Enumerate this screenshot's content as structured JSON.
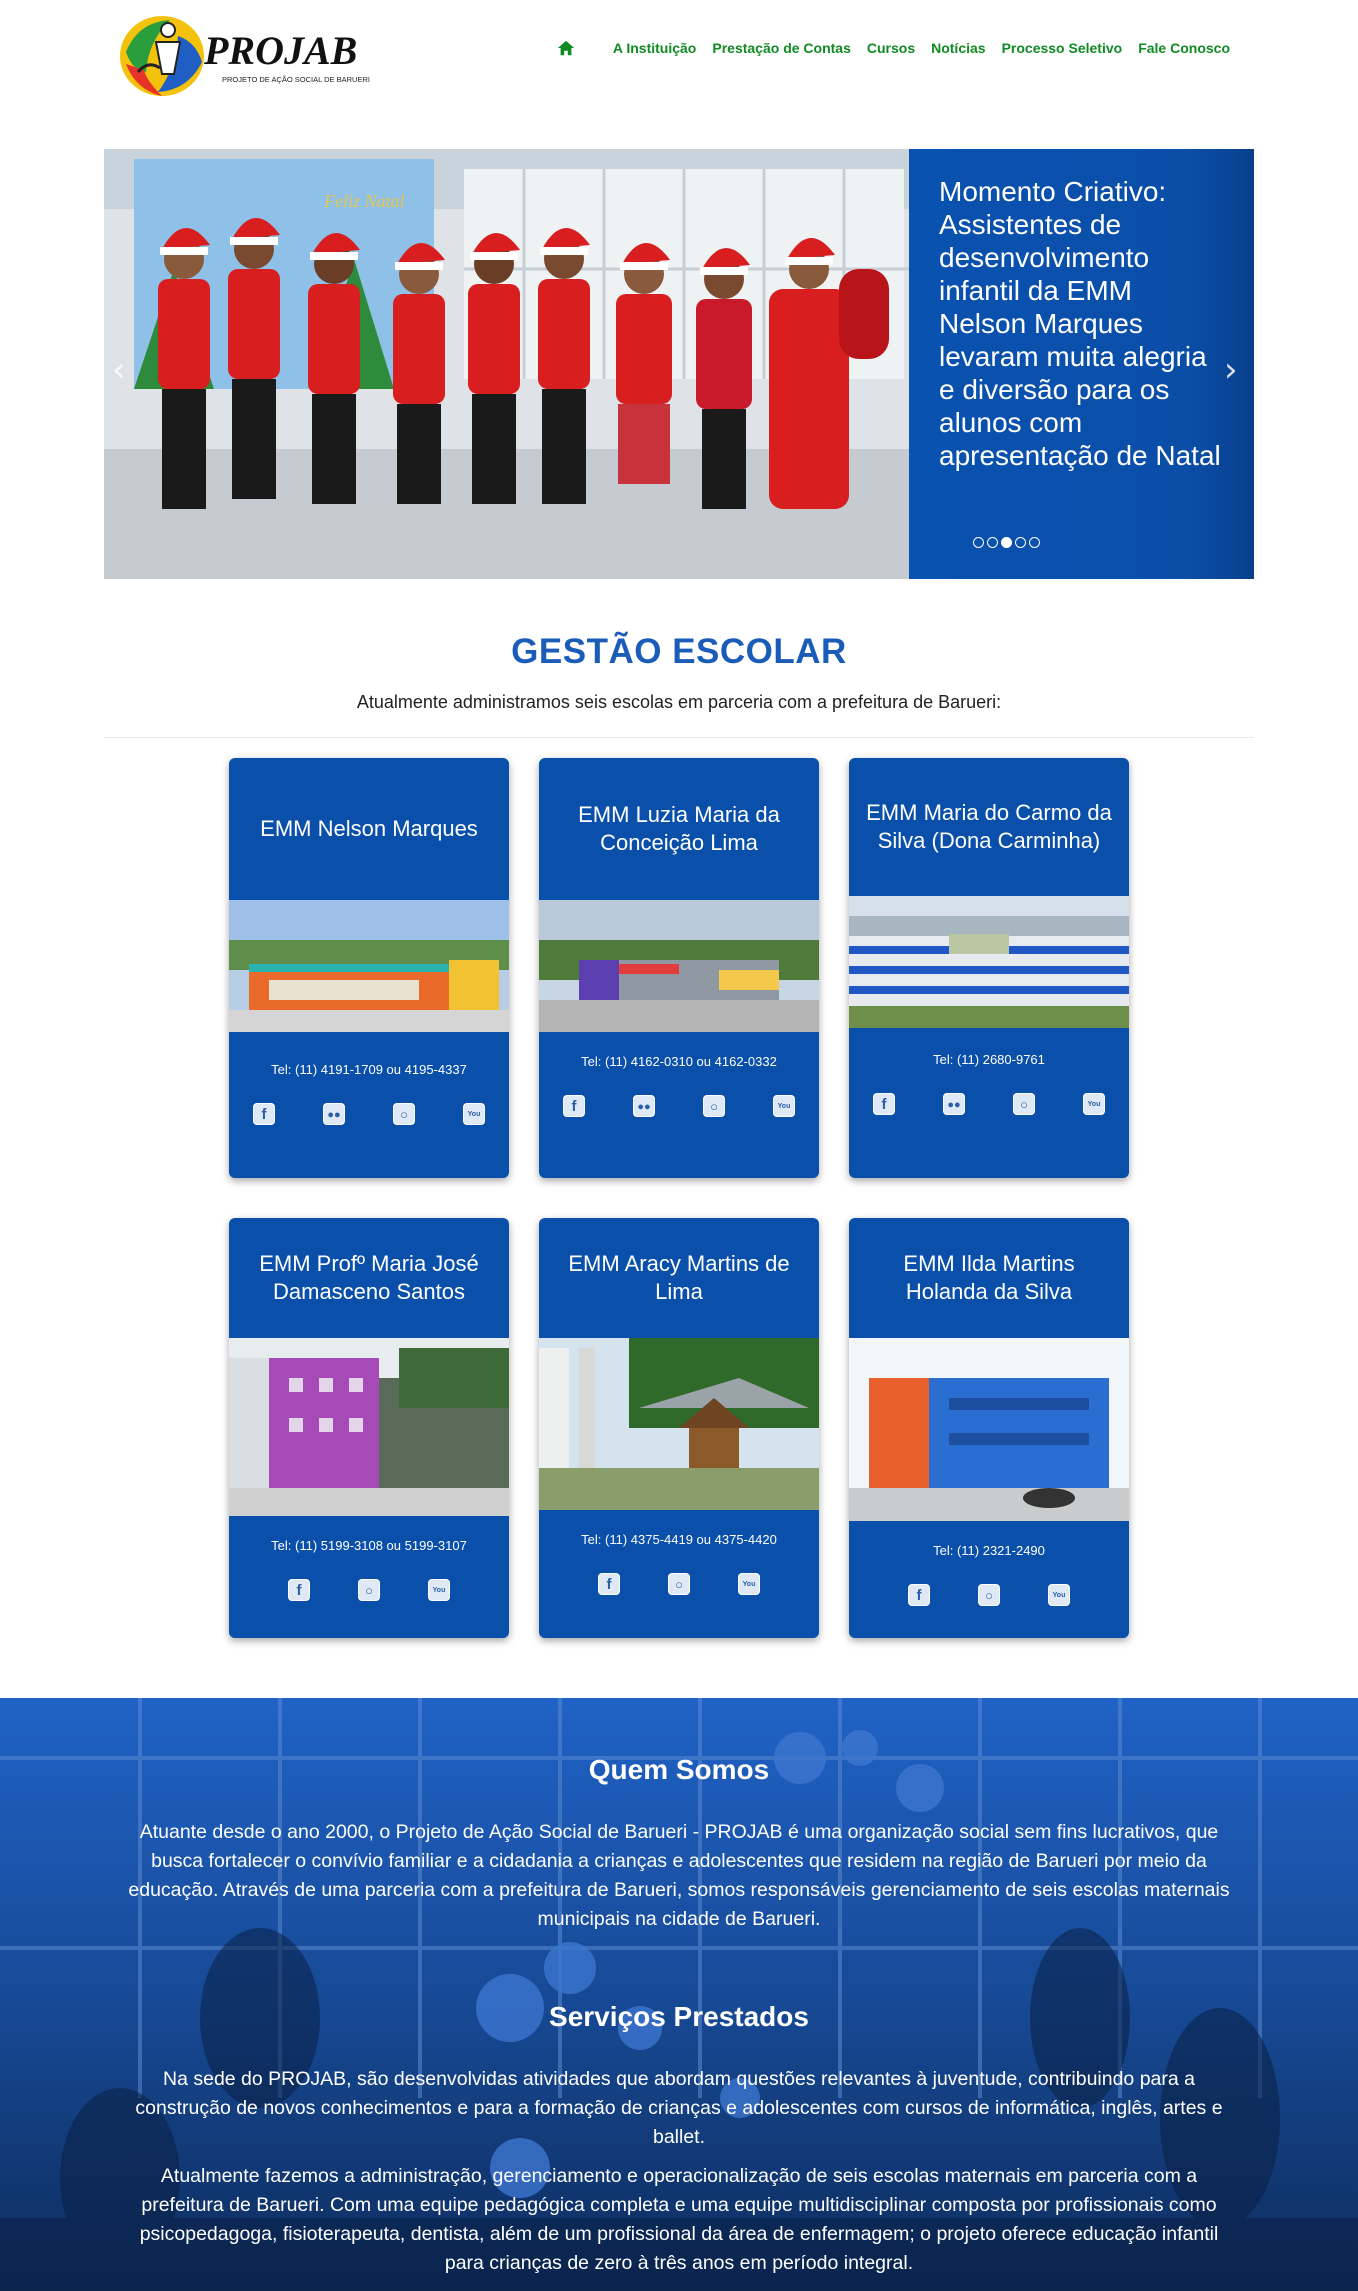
{
  "brand": {
    "name": "PROJAB",
    "tagline": "PROJETO DE AÇÃO SOCIAL DE BARUERI"
  },
  "nav": {
    "home_icon": "home-icon",
    "items": [
      "A Instituição",
      "Prestação de Contas",
      "Cursos",
      "Notícias",
      "Processo Seletivo",
      "Fale Conosco"
    ]
  },
  "carousel": {
    "photo_banner": "Feliz Natal",
    "caption": "Momento Criativo: Assistentes de desenvolvimento infantil da EMM Nelson Marques levaram muita alegria e diversão para os alunos com apresentação de Natal",
    "slide_count": 5,
    "active_index": 2,
    "prev_icon": "chevron-left-icon",
    "next_icon": "chevron-right-icon"
  },
  "gestao": {
    "title": "GESTÃO ESCOLAR",
    "subtitle": "Atualmente administramos seis escolas em parceria com a prefeitura de Barueri:"
  },
  "schools": [
    {
      "name": "EMM Nelson Marques",
      "tel": "Tel: (11) 4191-1709 ou 4195-4337",
      "icons": [
        "facebook-icon",
        "flickr-icon",
        "instagram-icon",
        "youtube-icon"
      ]
    },
    {
      "name": "EMM Luzia Maria da Conceição Lima",
      "tel": "Tel: (11) 4162-0310 ou 4162-0332",
      "icons": [
        "facebook-icon",
        "flickr-icon",
        "instagram-icon",
        "youtube-icon"
      ]
    },
    {
      "name": "EMM Maria do Carmo da Silva (Dona Carminha)",
      "tel": "Tel: (11) 2680-9761",
      "icons": [
        "facebook-icon",
        "flickr-icon",
        "instagram-icon",
        "youtube-icon"
      ]
    },
    {
      "name": "EMM Profº Maria José Damasceno Santos",
      "tel": "Tel: (11) 5199-3108 ou 5199-3107",
      "icons": [
        "facebook-icon",
        "instagram-icon",
        "youtube-icon"
      ]
    },
    {
      "name": "EMM Aracy Martins de Lima",
      "tel": "Tel: (11) 4375-4419 ou 4375-4420",
      "icons": [
        "facebook-icon",
        "instagram-icon",
        "youtube-icon"
      ]
    },
    {
      "name": "EMM Ilda Martins Holanda da Silva",
      "tel": "Tel: (11) 2321-2490",
      "icons": [
        "facebook-icon",
        "instagram-icon",
        "youtube-icon"
      ]
    }
  ],
  "about": {
    "title": "Quem Somos",
    "text": "Atuante desde o ano 2000, o Projeto de Ação Social de Barueri - PROJAB é uma organização social sem fins lucrativos, que busca fortalecer o convívio familiar e a cidadania a crianças e adolescentes que residem na região de Barueri por meio da educação. Através de uma parceria com a prefeitura de Barueri, somos responsáveis gerenciamento de seis escolas maternais municipais na cidade de Barueri."
  },
  "services": {
    "title": "Serviços Prestados",
    "text1": "Na sede do PROJAB, são desenvolvidas atividades que abordam questões relevantes à juventude, contribuindo para a construção de novos conhecimentos e para a formação de crianças e adolescentes com cursos de informática, inglês, artes e ballet.",
    "text2": "Atualmente fazemos a administração, gerenciamento e operacionalização de seis escolas maternais em parceria com a prefeitura de Barueri. Com uma equipe pedagógica completa e uma equipe multidisciplinar composta por profissionais como psicopedagoga, fisioterapeuta, dentista, além de um profissional da área de enfermagem; o projeto oferece educação infantil para crianças de zero à três anos em período integral."
  },
  "colors": {
    "nav_green": "#118a24",
    "brand_blue": "#0a50aa",
    "title_blue": "#1a5cb8"
  }
}
